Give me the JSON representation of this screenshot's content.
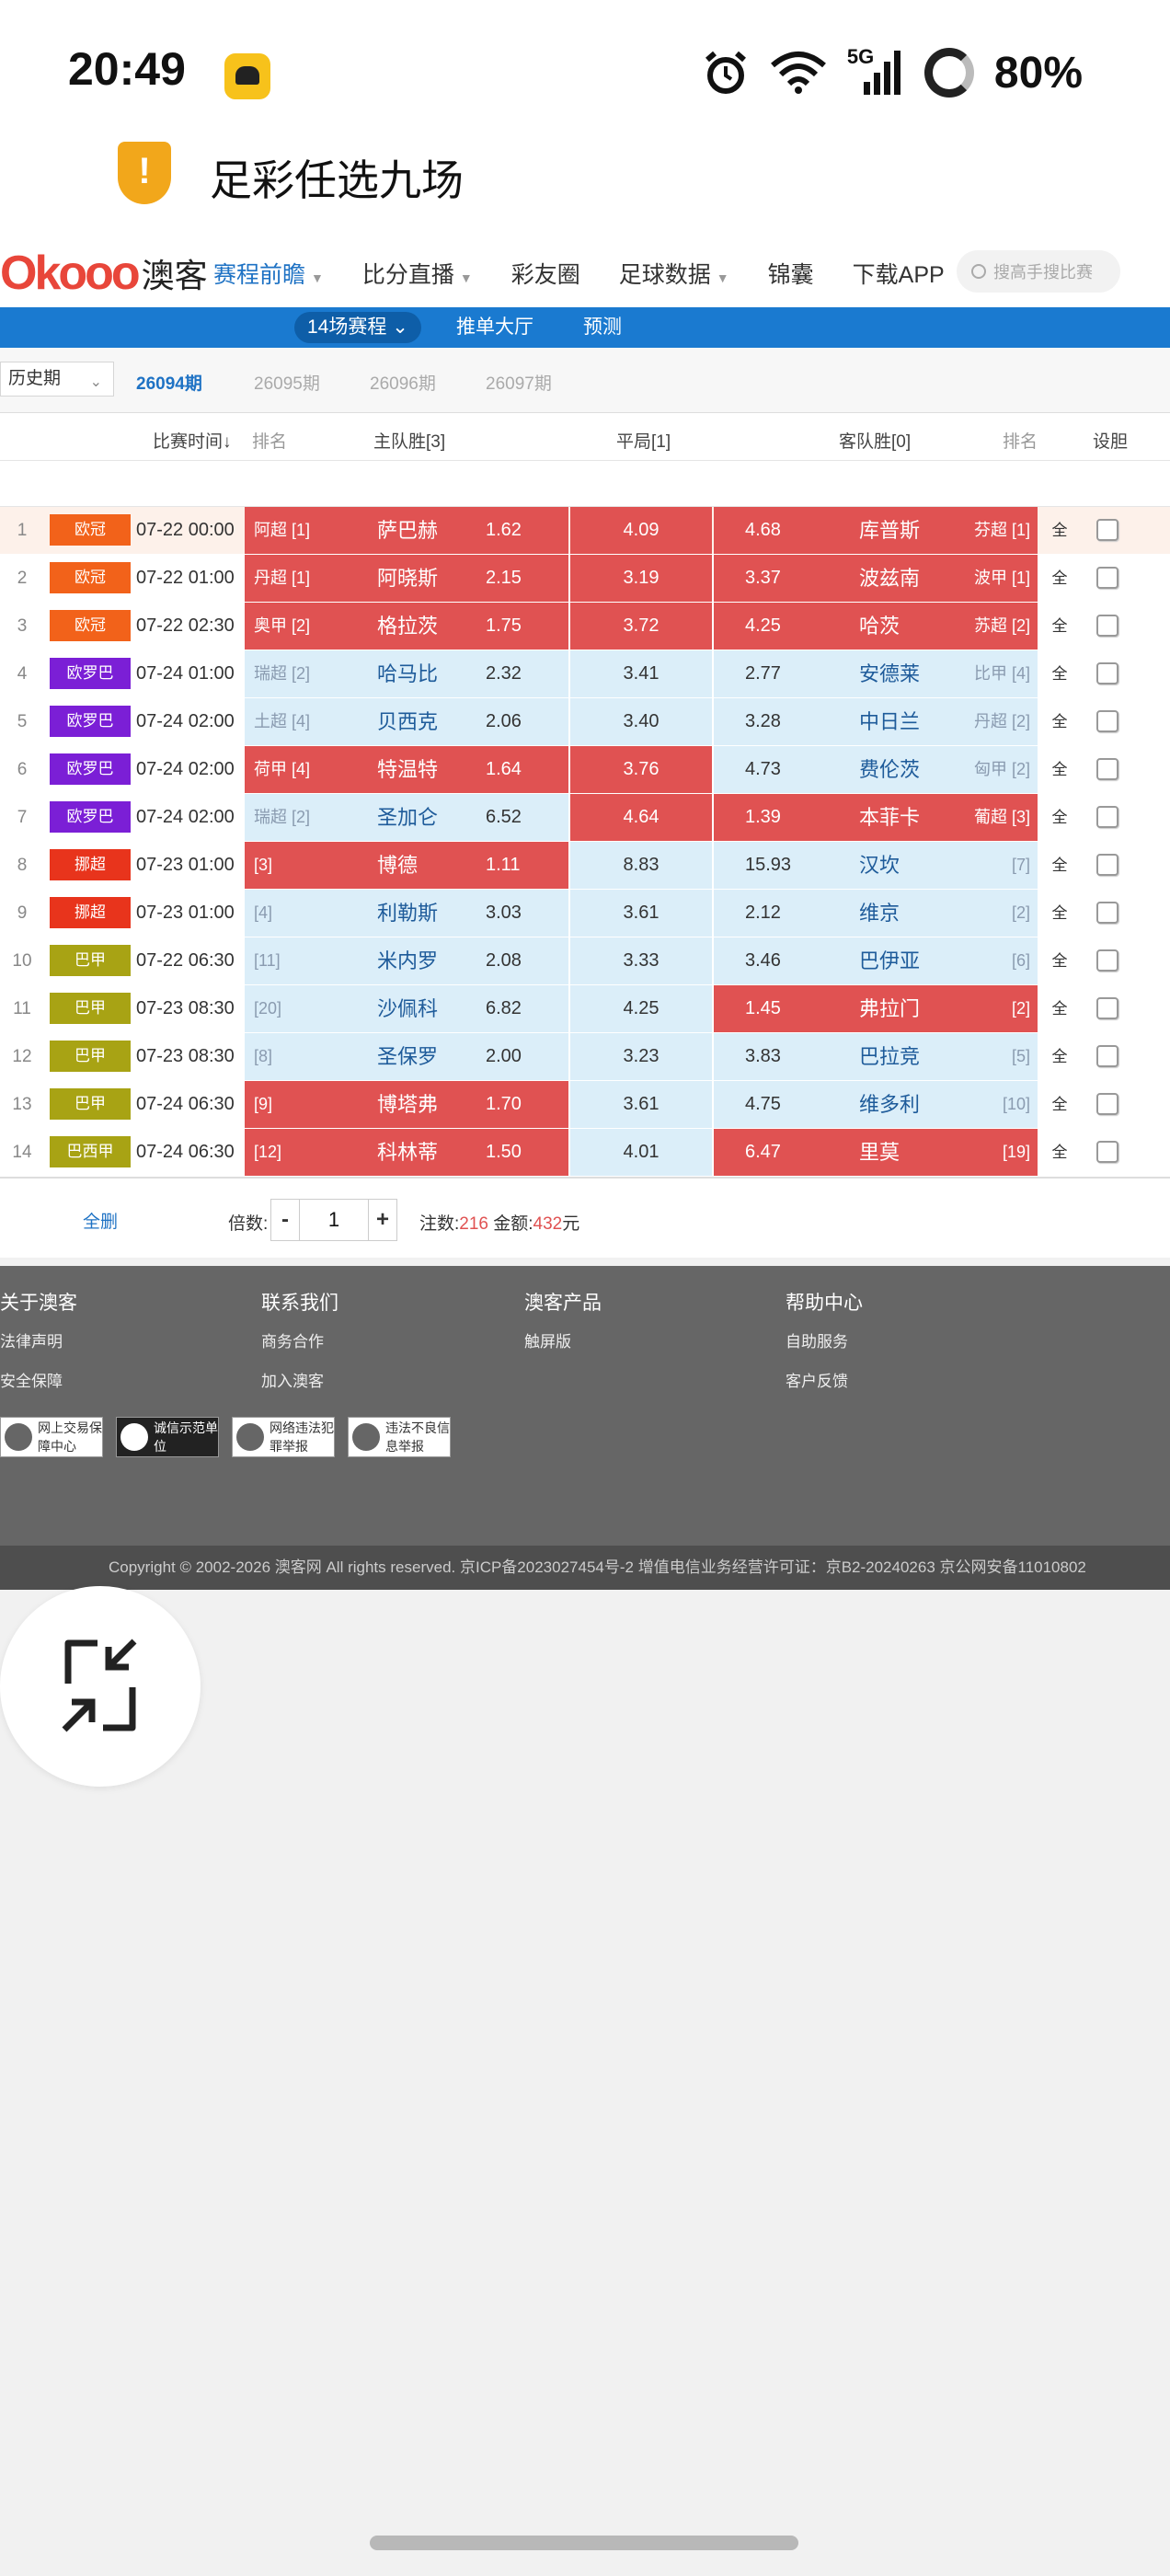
{
  "status": {
    "time": "20:49",
    "network": "5G",
    "battery": "80%"
  },
  "app": {
    "title": "足彩任选九场",
    "warning_glyph": "!"
  },
  "site": {
    "logo_ok": "Okooo",
    "logo_cn": "澳客",
    "nav": [
      {
        "label": "赛程前瞻",
        "active": true,
        "caret": true
      },
      {
        "label": "比分直播",
        "active": false,
        "caret": true
      },
      {
        "label": "彩友圈",
        "active": false,
        "caret": false
      },
      {
        "label": "足球数据",
        "active": false,
        "caret": true
      },
      {
        "label": "锦囊",
        "active": false,
        "caret": false
      },
      {
        "label": "下载APP",
        "active": false,
        "caret": false
      }
    ],
    "search_placeholder": "搜高手搜比赛"
  },
  "subnav": {
    "tab1": "14场赛程",
    "tab2": "推单大厅",
    "tab3": "预测"
  },
  "periods": {
    "history": "历史期",
    "p1": "26094期",
    "p2": "26095期",
    "p3": "26096期",
    "p4": "26097期"
  },
  "table": {
    "headers": {
      "time": "比赛时间↓",
      "rank_home": "排名",
      "home": "主队胜[3]",
      "draw": "平局[1]",
      "away": "客队胜[0]",
      "rank_away": "排名",
      "banker": "设胆"
    },
    "all_label": "全",
    "rows": [
      {
        "idx": "1",
        "league": "欧冠",
        "lc": "#f2621a",
        "time": "07-22 00:00",
        "hr": "阿超 [1]",
        "home": "萨巴赫",
        "ho": "1.62",
        "draw": "4.09",
        "ao": "4.68",
        "away": "库普斯",
        "ar": "芬超 [1]",
        "hs": "hi",
        "ds": "hi",
        "as": "hi"
      },
      {
        "idx": "2",
        "league": "欧冠",
        "lc": "#f2621a",
        "time": "07-22 01:00",
        "hr": "丹超 [1]",
        "home": "阿晓斯",
        "ho": "2.15",
        "draw": "3.19",
        "ao": "3.37",
        "away": "波兹南",
        "ar": "波甲 [1]",
        "hs": "hi",
        "ds": "hi",
        "as": "hi"
      },
      {
        "idx": "3",
        "league": "欧冠",
        "lc": "#f2621a",
        "time": "07-22 02:30",
        "hr": "奥甲 [2]",
        "home": "格拉茨",
        "ho": "1.75",
        "draw": "3.72",
        "ao": "4.25",
        "away": "哈茨",
        "ar": "苏超 [2]",
        "hs": "hi",
        "ds": "hi",
        "as": "hi"
      },
      {
        "idx": "4",
        "league": "欧罗巴",
        "lc": "#7b1fd6",
        "time": "07-24 01:00",
        "hr": "瑞超 [2]",
        "home": "哈马比",
        "ho": "2.32",
        "draw": "3.41",
        "ao": "2.77",
        "away": "安德莱",
        "ar": "比甲 [4]",
        "hs": "lo",
        "ds": "lo",
        "as": "lo"
      },
      {
        "idx": "5",
        "league": "欧罗巴",
        "lc": "#7b1fd6",
        "time": "07-24 02:00",
        "hr": "土超 [4]",
        "home": "贝西克",
        "ho": "2.06",
        "draw": "3.40",
        "ao": "3.28",
        "away": "中日兰",
        "ar": "丹超 [2]",
        "hs": "lo",
        "ds": "lo",
        "as": "lo"
      },
      {
        "idx": "6",
        "league": "欧罗巴",
        "lc": "#7b1fd6",
        "time": "07-24 02:00",
        "hr": "荷甲 [4]",
        "home": "特温特",
        "ho": "1.64",
        "draw": "3.76",
        "ao": "4.73",
        "away": "费伦茨",
        "ar": "匈甲 [2]",
        "hs": "hi",
        "ds": "hi",
        "as": "lo"
      },
      {
        "idx": "7",
        "league": "欧罗巴",
        "lc": "#7b1fd6",
        "time": "07-24 02:00",
        "hr": "瑞超 [2]",
        "home": "圣加仑",
        "ho": "6.52",
        "draw": "4.64",
        "ao": "1.39",
        "away": "本菲卡",
        "ar": "葡超 [3]",
        "hs": "lo",
        "ds": "hi",
        "as": "hi"
      },
      {
        "idx": "8",
        "league": "挪超",
        "lc": "#e8341c",
        "time": "07-23 01:00",
        "hr": "[3]",
        "home": "博德",
        "ho": "1.11",
        "draw": "8.83",
        "ao": "15.93",
        "away": "汉坎",
        "ar": "[7]",
        "hs": "hi",
        "ds": "lo",
        "as": "lo"
      },
      {
        "idx": "9",
        "league": "挪超",
        "lc": "#e8341c",
        "time": "07-23 01:00",
        "hr": "[4]",
        "home": "利勒斯",
        "ho": "3.03",
        "draw": "3.61",
        "ao": "2.12",
        "away": "维京",
        "ar": "[2]",
        "hs": "lo",
        "ds": "lo",
        "as": "lo"
      },
      {
        "idx": "10",
        "league": "巴甲",
        "lc": "#a8a314",
        "time": "07-22 06:30",
        "hr": "[11]",
        "home": "米内罗",
        "ho": "2.08",
        "draw": "3.33",
        "ao": "3.46",
        "away": "巴伊亚",
        "ar": "[6]",
        "hs": "lo",
        "ds": "lo",
        "as": "lo"
      },
      {
        "idx": "11",
        "league": "巴甲",
        "lc": "#a8a314",
        "time": "07-23 08:30",
        "hr": "[20]",
        "home": "沙佩科",
        "ho": "6.82",
        "draw": "4.25",
        "ao": "1.45",
        "away": "弗拉门",
        "ar": "[2]",
        "hs": "lo",
        "ds": "lo",
        "as": "hi"
      },
      {
        "idx": "12",
        "league": "巴甲",
        "lc": "#a8a314",
        "time": "07-23 08:30",
        "hr": "[8]",
        "home": "圣保罗",
        "ho": "2.00",
        "draw": "3.23",
        "ao": "3.83",
        "away": "巴拉竞",
        "ar": "[5]",
        "hs": "lo",
        "ds": "lo",
        "as": "lo"
      },
      {
        "idx": "13",
        "league": "巴甲",
        "lc": "#a8a314",
        "time": "07-24 06:30",
        "hr": "[9]",
        "home": "博塔弗",
        "ho": "1.70",
        "draw": "3.61",
        "ao": "4.75",
        "away": "维多利",
        "ar": "[10]",
        "hs": "hi",
        "ds": "lo",
        "as": "lo"
      },
      {
        "idx": "14",
        "league": "巴西甲",
        "lc": "#a8a314",
        "time": "07-24 06:30",
        "hr": "[12]",
        "home": "科林蒂",
        "ho": "1.50",
        "draw": "4.01",
        "ao": "6.47",
        "away": "里莫",
        "ar": "[19]",
        "hs": "hi",
        "ds": "lo",
        "as": "hi"
      }
    ]
  },
  "ops": {
    "delete_all": "全删",
    "multiple_label": "倍数:",
    "minus": "-",
    "plus": "+",
    "multiple_value": "1",
    "bets_label": "注数:",
    "bets_value": "216",
    "amount_label": "金额:",
    "amount_value": "432",
    "amount_unit": "元"
  },
  "footer": {
    "col1": {
      "title": "关于澳客",
      "l1": "法律声明",
      "l2": "安全保障"
    },
    "col2": {
      "title": "联系我们",
      "l1": "商务合作",
      "l2": "加入澳客"
    },
    "col3": {
      "title": "澳客产品",
      "l1": "触屏版"
    },
    "col4": {
      "title": "帮助中心",
      "l1": "自助服务",
      "l2": "客户反馈"
    },
    "badges": [
      "网上交易保障中心",
      "诚信示范单位",
      "网络违法犯罪举报",
      "违法不良信息举报"
    ],
    "copyright": "Copyright © 2002-2026 澳客网  All rights reserved.    京ICP备2023027454号-2  增值电信业务经营许可证：京B2-20240263  京公网安备11010802"
  }
}
